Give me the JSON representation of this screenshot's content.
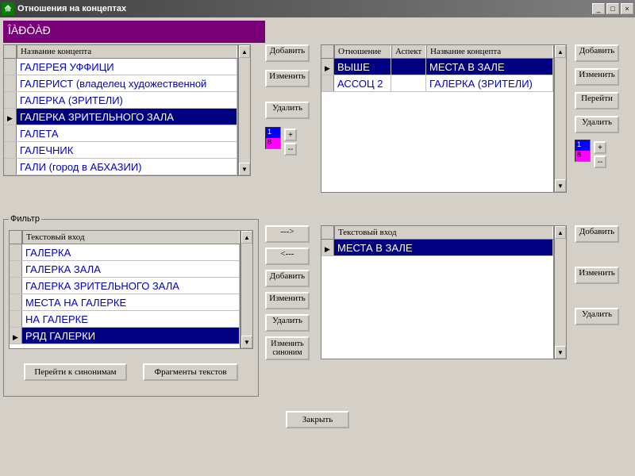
{
  "window": {
    "title": "Отношения на концептах"
  },
  "header_text": "ÎÀÐÒÀÐ",
  "concept_grid": {
    "header": "Название концепта",
    "rows": [
      "ГАЛЕРЕЯ УФФИЦИ",
      "ГАЛЕРИСТ (владелец художественной",
      "ГАЛЕРКА (ЗРИТЕЛИ)",
      "ГАЛЕРКА ЗРИТЕЛЬНОГО ЗАЛА",
      "ГАЛЕТА",
      "ГАЛЕЧНИК",
      "ГАЛИ (город в АБХАЗИИ)"
    ],
    "selected": 3
  },
  "left_buttons": {
    "add": "Добавить",
    "edit": "Изменить",
    "del": "Удалить"
  },
  "colorvals": {
    "a": "1",
    "b": "8"
  },
  "relations_grid": {
    "h1": "Отношение",
    "h2": "Аспект",
    "h3": "Название концепта",
    "rows": [
      {
        "rel": "ВЫШЕ",
        "asp": "",
        "name": "МЕСТА В ЗАЛЕ"
      },
      {
        "rel": "АССОЦ 2",
        "asp": "",
        "name": "ГАЛЕРКА (ЗРИТЕЛИ)"
      }
    ],
    "selected": 0
  },
  "right_buttons": {
    "add": "Добавить",
    "edit": "Изменить",
    "go": "Перейти",
    "del": "Удалить"
  },
  "right_colorvals": {
    "a": "1",
    "b": "8"
  },
  "filter": {
    "legend": "Фильтр",
    "header": "Текстовый вход",
    "rows": [
      "ГАЛЕРКА",
      "ГАЛЕРКА ЗАЛА",
      "ГАЛЕРКА ЗРИТЕЛЬНОГО ЗАЛА",
      "МЕСТА НА ГАЛЕРКЕ",
      "НА ГАЛЕРКЕ",
      "РЯД ГАЛЕРКИ"
    ],
    "selected": 5
  },
  "mid_buttons": {
    "fwd": "--->",
    "back": "<---",
    "add": "Добавить",
    "edit": "Изменить",
    "del": "Удалить",
    "editsyn": "Изменить синоним"
  },
  "text_in_grid": {
    "header": "Текстовый вход",
    "rows": [
      "МЕСТА В ЗАЛЕ"
    ],
    "selected": 0
  },
  "right2_buttons": {
    "add": "Добавить",
    "edit": "Изменить",
    "del": "Удалить"
  },
  "bottom": {
    "syn": "Перейти к синонимам",
    "frag": "Фрагменты текстов",
    "close": "Закрыть"
  }
}
